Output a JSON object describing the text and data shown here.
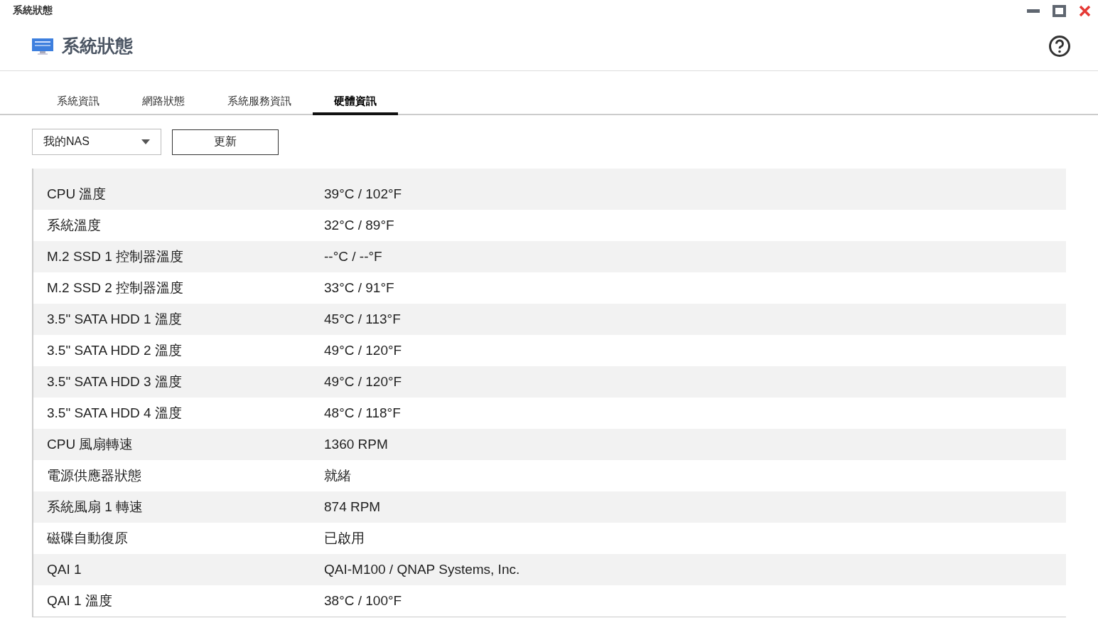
{
  "window": {
    "title": "系統狀態"
  },
  "header": {
    "title": "系統狀態"
  },
  "tabs": [
    {
      "label": "系統資訊",
      "selected": false
    },
    {
      "label": "網路狀態",
      "selected": false
    },
    {
      "label": "系統服務資訊",
      "selected": false
    },
    {
      "label": "硬體資訊",
      "selected": true
    }
  ],
  "device_select": {
    "value": "我的NAS"
  },
  "refresh_button": {
    "label": "更新"
  },
  "table": {
    "rows": [
      {
        "name": "CPU 溫度",
        "value": "39°C / 102°F"
      },
      {
        "name": "系統溫度",
        "value": "32°C / 89°F"
      },
      {
        "name": "M.2 SSD 1 控制器溫度",
        "value": "--°C / --°F"
      },
      {
        "name": "M.2 SSD 2 控制器溫度",
        "value": "33°C / 91°F"
      },
      {
        "name": "3.5\" SATA HDD 1 溫度",
        "value": "45°C / 113°F"
      },
      {
        "name": "3.5\" SATA HDD 2 溫度",
        "value": "49°C / 120°F"
      },
      {
        "name": "3.5\" SATA HDD 3 溫度",
        "value": "49°C / 120°F"
      },
      {
        "name": "3.5\" SATA HDD 4 溫度",
        "value": "48°C / 118°F"
      },
      {
        "name": "CPU 風扇轉速",
        "value": "1360 RPM"
      },
      {
        "name": "電源供應器狀態",
        "value": "就緒"
      },
      {
        "name": "系統風扇 1 轉速",
        "value": "874 RPM"
      },
      {
        "name": "磁碟自動復原",
        "value": "已啟用"
      },
      {
        "name": "QAI 1",
        "value": "QAI-M100 / QNAP Systems, Inc."
      },
      {
        "name": "QAI 1 溫度",
        "value": "38°C / 100°F"
      }
    ]
  }
}
